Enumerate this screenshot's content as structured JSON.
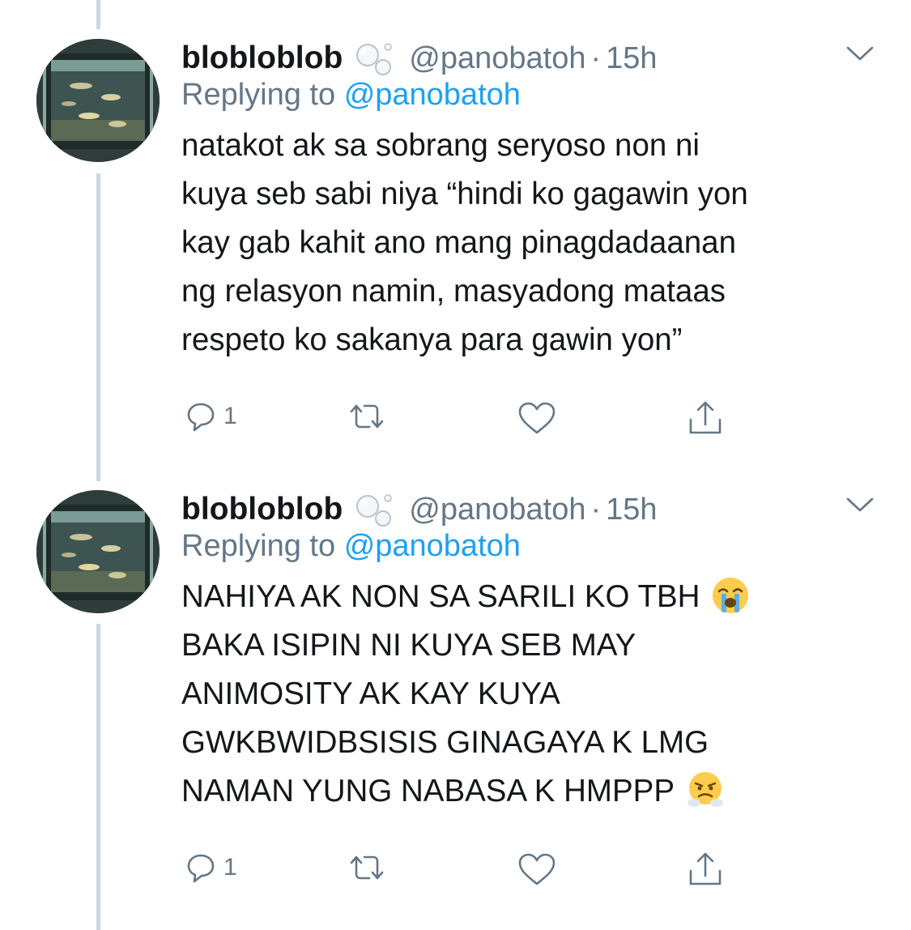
{
  "colors": {
    "text": "#14171a",
    "secondary": "#657786",
    "link": "#1da1f2",
    "thread_line": "#cdd6dd",
    "icon": "#657786"
  },
  "tweets": [
    {
      "display_name": "blobloblob",
      "handle": "@panobatoh",
      "separator": "·",
      "time": "15h",
      "replying_prefix": "Replying to",
      "replying_mention": "@panobatoh",
      "lines": [
        "natakot ak sa sobrang seryoso non ni",
        "kuya seb sabi niya “hindi ko gagawin yon",
        "kay gab kahit ano mang pinagdadaanan",
        "ng relasyon namin, masyadong mataas",
        "respeto ko sakanya para gawin yon”"
      ],
      "reply_count": "1",
      "icons": [
        "avatar-aquarium",
        "bubbles-emoji",
        "chevron-down-icon",
        "reply-icon",
        "retweet-icon",
        "like-icon",
        "share-icon"
      ]
    },
    {
      "display_name": "blobloblob",
      "handle": "@panobatoh",
      "separator": "·",
      "time": "15h",
      "replying_prefix": "Replying to",
      "replying_mention": "@panobatoh",
      "lines": [
        "NAHIYA AK NON SA SARILI KO TBH",
        "BAKA ISIPIN NI KUYA SEB MAY",
        "ANIMOSITY AK KAY KUYA",
        "GWKBWIDBSISIS GINAGAYA K LMG",
        "NAMAN YUNG NABASA K HMPPP"
      ],
      "line_emojis": {
        "0": "loudly-crying-face",
        "4": "face-with-steam"
      },
      "reply_count": "1",
      "icons": [
        "avatar-aquarium",
        "bubbles-emoji",
        "chevron-down-icon",
        "reply-icon",
        "retweet-icon",
        "like-icon",
        "share-icon"
      ]
    }
  ]
}
